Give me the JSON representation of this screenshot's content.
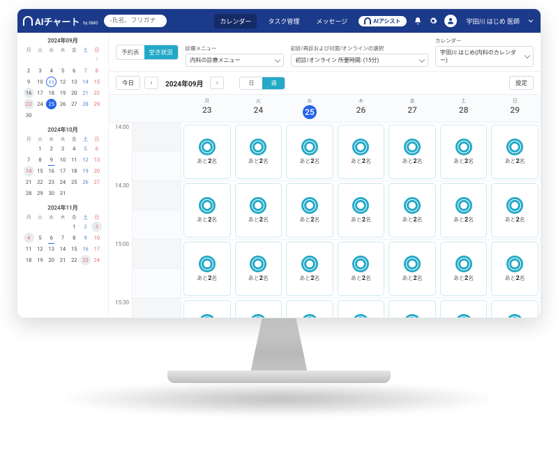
{
  "brand": {
    "name": "AIチャート",
    "suffix": "by GMO"
  },
  "search": {
    "placeholder": "氏名、フリガナ"
  },
  "headerTabs": {
    "calendar": "カレンダー",
    "tasks": "タスク管理",
    "messages": "メッセージ",
    "aiAssist": "AIアシスト"
  },
  "user": {
    "name": "宇田川 はじめ 医師"
  },
  "filters": {
    "tabReserve": "予約表",
    "tabSlots": "空き状況",
    "menuLabel": "診療メニュー",
    "menuValue": "内科の診療メニュー",
    "visitLabel": "初診/再診および対面/オンラインの選択",
    "visitValue": "初診/オンライン 所要時間: (15分)",
    "calLabel": "カレンダー",
    "calValue": "宇田川 はじめ(内科のカレンダー)"
  },
  "nav": {
    "today": "今日",
    "prev": "‹",
    "next": "›",
    "period": "2024年09月",
    "viewDay": "日",
    "viewWeek": "週",
    "settings": "設定"
  },
  "weekdaysShort": [
    "月",
    "火",
    "水",
    "木",
    "金",
    "土",
    "日"
  ],
  "weekHead": [
    {
      "dow": "月",
      "num": "23",
      "today": false
    },
    {
      "dow": "火",
      "num": "24",
      "today": false
    },
    {
      "dow": "水",
      "num": "25",
      "today": true
    },
    {
      "dow": "木",
      "num": "26",
      "today": false
    },
    {
      "dow": "金",
      "num": "27",
      "today": false
    },
    {
      "dow": "土",
      "num": "28",
      "today": false
    },
    {
      "dow": "日",
      "num": "29",
      "today": false
    }
  ],
  "timeRows": [
    "14:00",
    "14:30",
    "15:00",
    "15:30"
  ],
  "slotCapacityPrefix": "あと",
  "slotCapacityNum": "2",
  "slotCapacitySuffix": "名",
  "miniCals": [
    {
      "title": "2024年09月",
      "cells": [
        [
          "",
          "",
          "",
          "",
          "",
          "",
          {
            "n": "1",
            "sun": true,
            "dim": true
          }
        ],
        [
          {
            "n": "2"
          },
          {
            "n": "3"
          },
          {
            "n": "4"
          },
          {
            "n": "5"
          },
          {
            "n": "6"
          },
          {
            "n": "7",
            "sat": true
          },
          {
            "n": "8",
            "sun": true
          }
        ],
        [
          {
            "n": "9"
          },
          {
            "n": "10"
          },
          {
            "n": "11",
            "outlined": true
          },
          {
            "n": "12"
          },
          {
            "n": "13"
          },
          {
            "n": "14",
            "sat": true
          },
          {
            "n": "15",
            "sun": true
          }
        ],
        [
          {
            "n": "16",
            "grey": true
          },
          {
            "n": "17"
          },
          {
            "n": "18"
          },
          {
            "n": "19"
          },
          {
            "n": "20"
          },
          {
            "n": "21",
            "sat": true
          },
          {
            "n": "22",
            "sun": true
          }
        ],
        [
          {
            "n": "23",
            "grey": true,
            "sun": true
          },
          {
            "n": "24"
          },
          {
            "n": "25",
            "filled": true
          },
          {
            "n": "26"
          },
          {
            "n": "27"
          },
          {
            "n": "28",
            "sat": true
          },
          {
            "n": "29",
            "sun": true
          }
        ],
        [
          {
            "n": "30"
          },
          "",
          "",
          "",
          "",
          "",
          ""
        ]
      ]
    },
    {
      "title": "2024年10月",
      "cells": [
        [
          "",
          {
            "n": "1"
          },
          {
            "n": "2"
          },
          {
            "n": "3"
          },
          {
            "n": "4"
          },
          {
            "n": "5",
            "sat": true
          },
          {
            "n": "6",
            "sun": true
          }
        ],
        [
          {
            "n": "7"
          },
          {
            "n": "8"
          },
          {
            "n": "9",
            "underline": true
          },
          {
            "n": "10"
          },
          {
            "n": "11"
          },
          {
            "n": "12",
            "sat": true
          },
          {
            "n": "13",
            "sun": true
          }
        ],
        [
          {
            "n": "14",
            "grey": true,
            "sun": true
          },
          {
            "n": "15"
          },
          {
            "n": "16"
          },
          {
            "n": "17"
          },
          {
            "n": "18"
          },
          {
            "n": "19",
            "sat": true
          },
          {
            "n": "20",
            "sun": true
          }
        ],
        [
          {
            "n": "21"
          },
          {
            "n": "22"
          },
          {
            "n": "23"
          },
          {
            "n": "24"
          },
          {
            "n": "25"
          },
          {
            "n": "26",
            "sat": true
          },
          {
            "n": "27",
            "sun": true
          }
        ],
        [
          {
            "n": "28"
          },
          {
            "n": "29"
          },
          {
            "n": "30"
          },
          {
            "n": "31"
          },
          "",
          "",
          ""
        ]
      ]
    },
    {
      "title": "2024年11月",
      "cells": [
        [
          "",
          "",
          "",
          "",
          {
            "n": "1"
          },
          {
            "n": "2",
            "sat": true
          },
          {
            "n": "3",
            "sun": true,
            "grey": true
          }
        ],
        [
          {
            "n": "4",
            "grey": true,
            "sun": true
          },
          {
            "n": "5"
          },
          {
            "n": "6",
            "underline": true
          },
          {
            "n": "7"
          },
          {
            "n": "8"
          },
          {
            "n": "9",
            "sat": true
          },
          {
            "n": "10",
            "sun": true
          }
        ],
        [
          {
            "n": "11"
          },
          {
            "n": "12"
          },
          {
            "n": "13"
          },
          {
            "n": "14"
          },
          {
            "n": "15"
          },
          {
            "n": "16",
            "sat": true
          },
          {
            "n": "17",
            "sun": true
          }
        ],
        [
          {
            "n": "18"
          },
          {
            "n": "19"
          },
          {
            "n": "20"
          },
          {
            "n": "21"
          },
          {
            "n": "22"
          },
          {
            "n": "23",
            "grey": true,
            "sun": true
          },
          {
            "n": "24",
            "sun": true
          }
        ]
      ]
    }
  ]
}
